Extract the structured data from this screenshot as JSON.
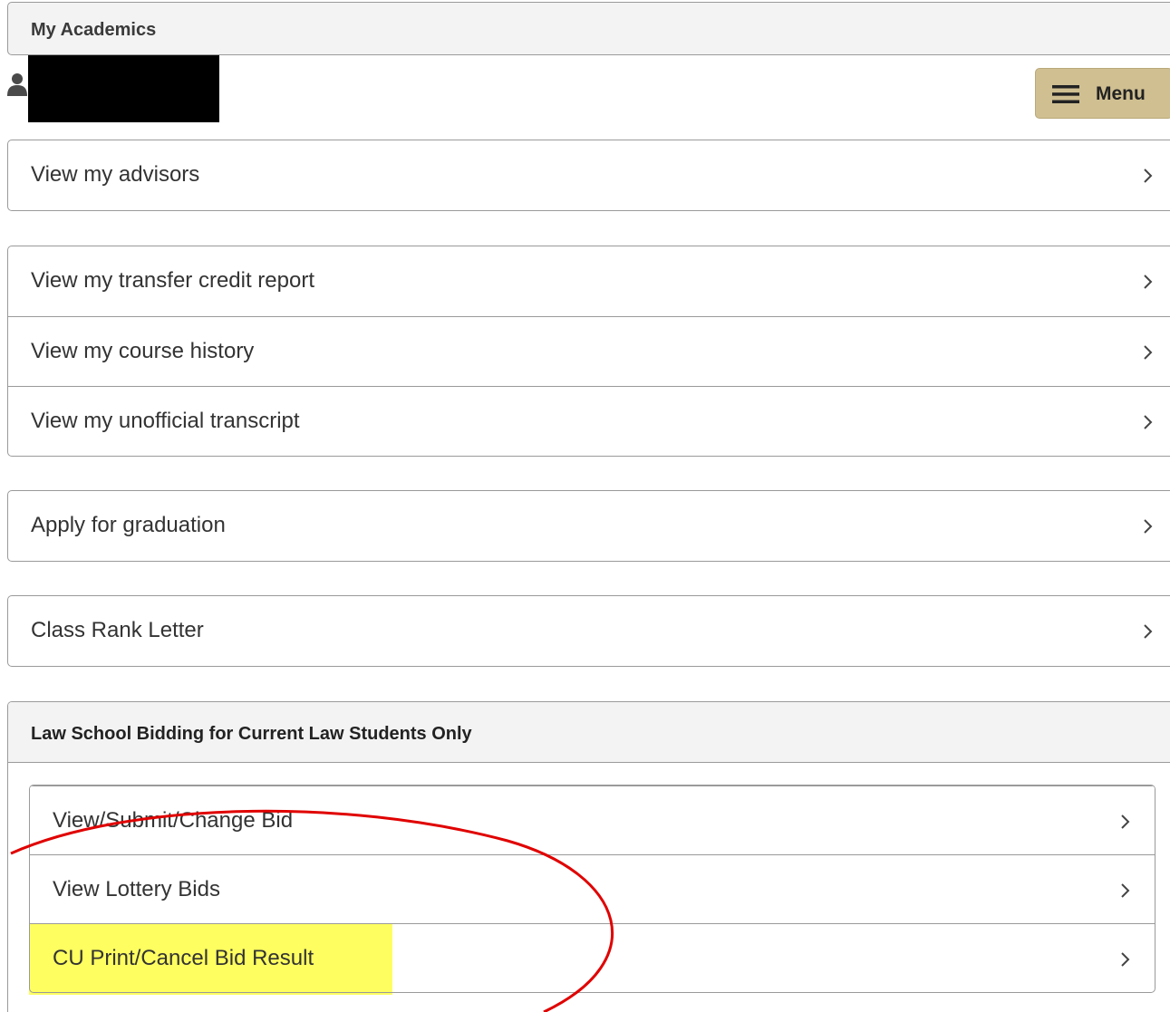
{
  "header": {
    "title": "My Academics"
  },
  "menu": {
    "label": "Menu"
  },
  "groups": [
    [
      {
        "label": "View my advisors"
      }
    ],
    [
      {
        "label": "View my transfer credit report"
      },
      {
        "label": "View my course history"
      },
      {
        "label": "View my unofficial transcript"
      }
    ],
    [
      {
        "label": "Apply for graduation"
      }
    ],
    [
      {
        "label": "Class Rank Letter"
      }
    ]
  ],
  "bidding": {
    "title": "Law School Bidding for Current Law Students Only",
    "items": [
      {
        "label": "View/Submit/Change Bid"
      },
      {
        "label": "View Lottery Bids"
      },
      {
        "label": "CU Print/Cancel Bid Result"
      }
    ]
  },
  "annotation": {
    "highlight_color": "#fefe60",
    "circle_color": "#e00000"
  }
}
